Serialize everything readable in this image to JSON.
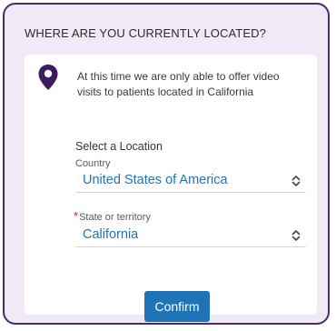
{
  "header": {
    "title": "WHERE ARE YOU CURRENTLY LOCATED?"
  },
  "card": {
    "message": "At this time we are only able to offer video visits to patients located in California",
    "select_location_label": "Select a Location",
    "country": {
      "label": "Country",
      "value": "United States of America"
    },
    "state": {
      "required_mark": "*",
      "label": "State or territory",
      "value": "California"
    },
    "confirm_label": "Confirm"
  },
  "icons": {
    "pin": "location-pin-icon",
    "chevron": "chevron-up-down-icon"
  },
  "colors": {
    "accent": "#1f73b7",
    "pin": "#3b1a5e",
    "frame_border": "#4a2a6e",
    "frame_bg": "#f1e9f6",
    "required": "#c0262d"
  }
}
